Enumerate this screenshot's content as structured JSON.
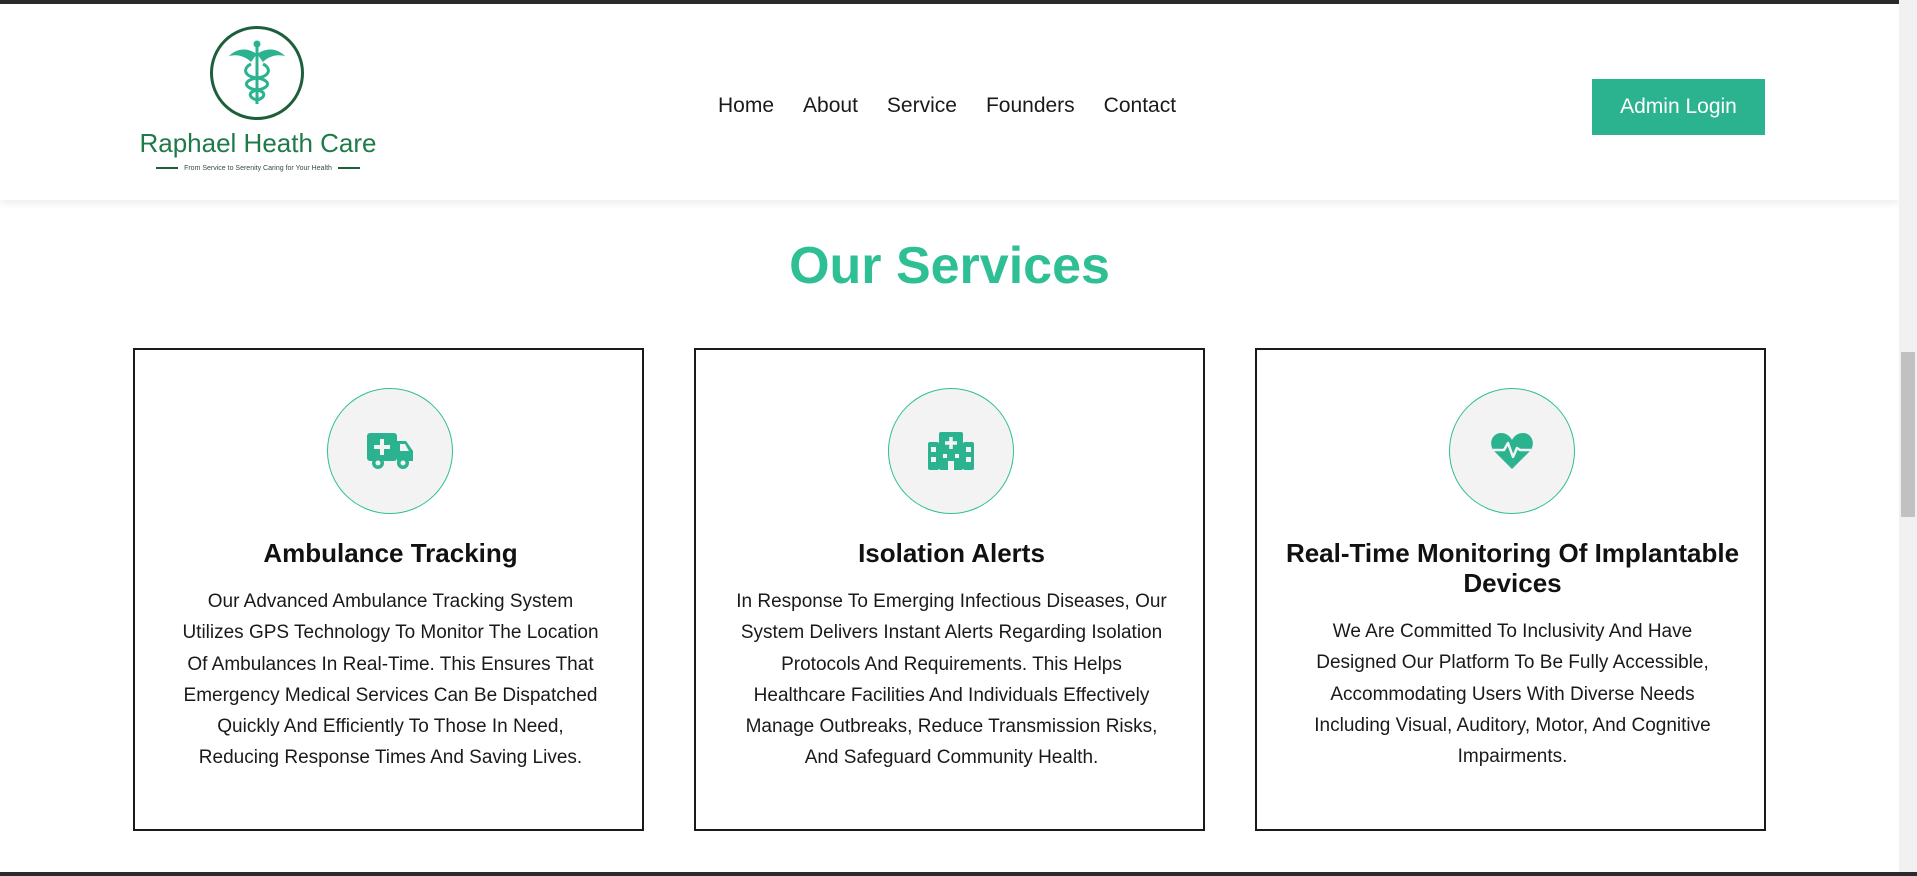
{
  "brand": {
    "name": "Raphael Heath Care",
    "tagline": "From Service to Serenity Caring for Your Health",
    "logo_icon": "caduceus-icon"
  },
  "nav": {
    "items": [
      {
        "label": "Home"
      },
      {
        "label": "About"
      },
      {
        "label": "Service"
      },
      {
        "label": "Founders"
      },
      {
        "label": "Contact"
      }
    ]
  },
  "header": {
    "admin_login_label": "Admin Login"
  },
  "services": {
    "title": "Our Services",
    "cards": [
      {
        "icon": "ambulance-icon",
        "title": "Ambulance Tracking",
        "lines": [
          "Our Advanced Ambulance Tracking System",
          "Utilizes GPS Technology To Monitor The Location",
          "Of Ambulances In Real-Time. This Ensures That",
          "Emergency Medical Services Can Be Dispatched",
          "Quickly And Efficiently To Those In Need,",
          "Reducing Response Times And Saving Lives."
        ]
      },
      {
        "icon": "hospital-icon",
        "title": "Isolation Alerts",
        "lines": [
          "In Response To Emerging Infectious Diseases, Our",
          "System Delivers Instant Alerts Regarding Isolation",
          "Protocols And Requirements. This Helps",
          "Healthcare Facilities And Individuals Effectively",
          "Manage Outbreaks, Reduce Transmission Risks,",
          "And Safeguard Community Health."
        ]
      },
      {
        "icon": "heart-pulse-icon",
        "title_lines": [
          "Real-Time Monitoring Of Implantable",
          "Devices"
        ],
        "lines": [
          "We Are Committed To Inclusivity And Have",
          "Designed Our Platform To Be Fully Accessible,",
          "Accommodating Users With Diverse Needs",
          "Including Visual, Auditory, Motor, And Cognitive",
          "Impairments."
        ]
      }
    ]
  },
  "colors": {
    "accent": "#2fbf94",
    "button": "#2bb38f",
    "brand_green": "#1f7a4a"
  }
}
